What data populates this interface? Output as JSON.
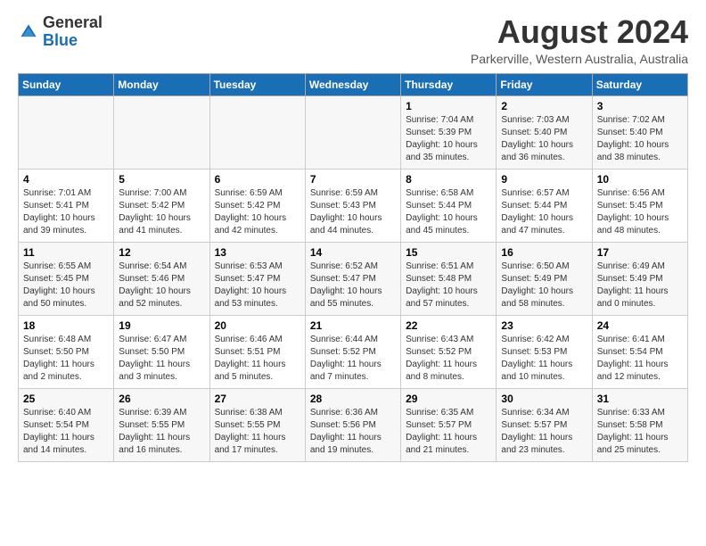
{
  "header": {
    "logo": {
      "general": "General",
      "blue": "Blue"
    },
    "title": "August 2024",
    "location": "Parkerville, Western Australia, Australia"
  },
  "calendar": {
    "days_of_week": [
      "Sunday",
      "Monday",
      "Tuesday",
      "Wednesday",
      "Thursday",
      "Friday",
      "Saturday"
    ],
    "weeks": [
      [
        {
          "day": "",
          "info": ""
        },
        {
          "day": "",
          "info": ""
        },
        {
          "day": "",
          "info": ""
        },
        {
          "day": "",
          "info": ""
        },
        {
          "day": "1",
          "info": "Sunrise: 7:04 AM\nSunset: 5:39 PM\nDaylight: 10 hours\nand 35 minutes."
        },
        {
          "day": "2",
          "info": "Sunrise: 7:03 AM\nSunset: 5:40 PM\nDaylight: 10 hours\nand 36 minutes."
        },
        {
          "day": "3",
          "info": "Sunrise: 7:02 AM\nSunset: 5:40 PM\nDaylight: 10 hours\nand 38 minutes."
        }
      ],
      [
        {
          "day": "4",
          "info": "Sunrise: 7:01 AM\nSunset: 5:41 PM\nDaylight: 10 hours\nand 39 minutes."
        },
        {
          "day": "5",
          "info": "Sunrise: 7:00 AM\nSunset: 5:42 PM\nDaylight: 10 hours\nand 41 minutes."
        },
        {
          "day": "6",
          "info": "Sunrise: 6:59 AM\nSunset: 5:42 PM\nDaylight: 10 hours\nand 42 minutes."
        },
        {
          "day": "7",
          "info": "Sunrise: 6:59 AM\nSunset: 5:43 PM\nDaylight: 10 hours\nand 44 minutes."
        },
        {
          "day": "8",
          "info": "Sunrise: 6:58 AM\nSunset: 5:44 PM\nDaylight: 10 hours\nand 45 minutes."
        },
        {
          "day": "9",
          "info": "Sunrise: 6:57 AM\nSunset: 5:44 PM\nDaylight: 10 hours\nand 47 minutes."
        },
        {
          "day": "10",
          "info": "Sunrise: 6:56 AM\nSunset: 5:45 PM\nDaylight: 10 hours\nand 48 minutes."
        }
      ],
      [
        {
          "day": "11",
          "info": "Sunrise: 6:55 AM\nSunset: 5:45 PM\nDaylight: 10 hours\nand 50 minutes."
        },
        {
          "day": "12",
          "info": "Sunrise: 6:54 AM\nSunset: 5:46 PM\nDaylight: 10 hours\nand 52 minutes."
        },
        {
          "day": "13",
          "info": "Sunrise: 6:53 AM\nSunset: 5:47 PM\nDaylight: 10 hours\nand 53 minutes."
        },
        {
          "day": "14",
          "info": "Sunrise: 6:52 AM\nSunset: 5:47 PM\nDaylight: 10 hours\nand 55 minutes."
        },
        {
          "day": "15",
          "info": "Sunrise: 6:51 AM\nSunset: 5:48 PM\nDaylight: 10 hours\nand 57 minutes."
        },
        {
          "day": "16",
          "info": "Sunrise: 6:50 AM\nSunset: 5:49 PM\nDaylight: 10 hours\nand 58 minutes."
        },
        {
          "day": "17",
          "info": "Sunrise: 6:49 AM\nSunset: 5:49 PM\nDaylight: 11 hours\nand 0 minutes."
        }
      ],
      [
        {
          "day": "18",
          "info": "Sunrise: 6:48 AM\nSunset: 5:50 PM\nDaylight: 11 hours\nand 2 minutes."
        },
        {
          "day": "19",
          "info": "Sunrise: 6:47 AM\nSunset: 5:50 PM\nDaylight: 11 hours\nand 3 minutes."
        },
        {
          "day": "20",
          "info": "Sunrise: 6:46 AM\nSunset: 5:51 PM\nDaylight: 11 hours\nand 5 minutes."
        },
        {
          "day": "21",
          "info": "Sunrise: 6:44 AM\nSunset: 5:52 PM\nDaylight: 11 hours\nand 7 minutes."
        },
        {
          "day": "22",
          "info": "Sunrise: 6:43 AM\nSunset: 5:52 PM\nDaylight: 11 hours\nand 8 minutes."
        },
        {
          "day": "23",
          "info": "Sunrise: 6:42 AM\nSunset: 5:53 PM\nDaylight: 11 hours\nand 10 minutes."
        },
        {
          "day": "24",
          "info": "Sunrise: 6:41 AM\nSunset: 5:54 PM\nDaylight: 11 hours\nand 12 minutes."
        }
      ],
      [
        {
          "day": "25",
          "info": "Sunrise: 6:40 AM\nSunset: 5:54 PM\nDaylight: 11 hours\nand 14 minutes."
        },
        {
          "day": "26",
          "info": "Sunrise: 6:39 AM\nSunset: 5:55 PM\nDaylight: 11 hours\nand 16 minutes."
        },
        {
          "day": "27",
          "info": "Sunrise: 6:38 AM\nSunset: 5:55 PM\nDaylight: 11 hours\nand 17 minutes."
        },
        {
          "day": "28",
          "info": "Sunrise: 6:36 AM\nSunset: 5:56 PM\nDaylight: 11 hours\nand 19 minutes."
        },
        {
          "day": "29",
          "info": "Sunrise: 6:35 AM\nSunset: 5:57 PM\nDaylight: 11 hours\nand 21 minutes."
        },
        {
          "day": "30",
          "info": "Sunrise: 6:34 AM\nSunset: 5:57 PM\nDaylight: 11 hours\nand 23 minutes."
        },
        {
          "day": "31",
          "info": "Sunrise: 6:33 AM\nSunset: 5:58 PM\nDaylight: 11 hours\nand 25 minutes."
        }
      ]
    ]
  }
}
